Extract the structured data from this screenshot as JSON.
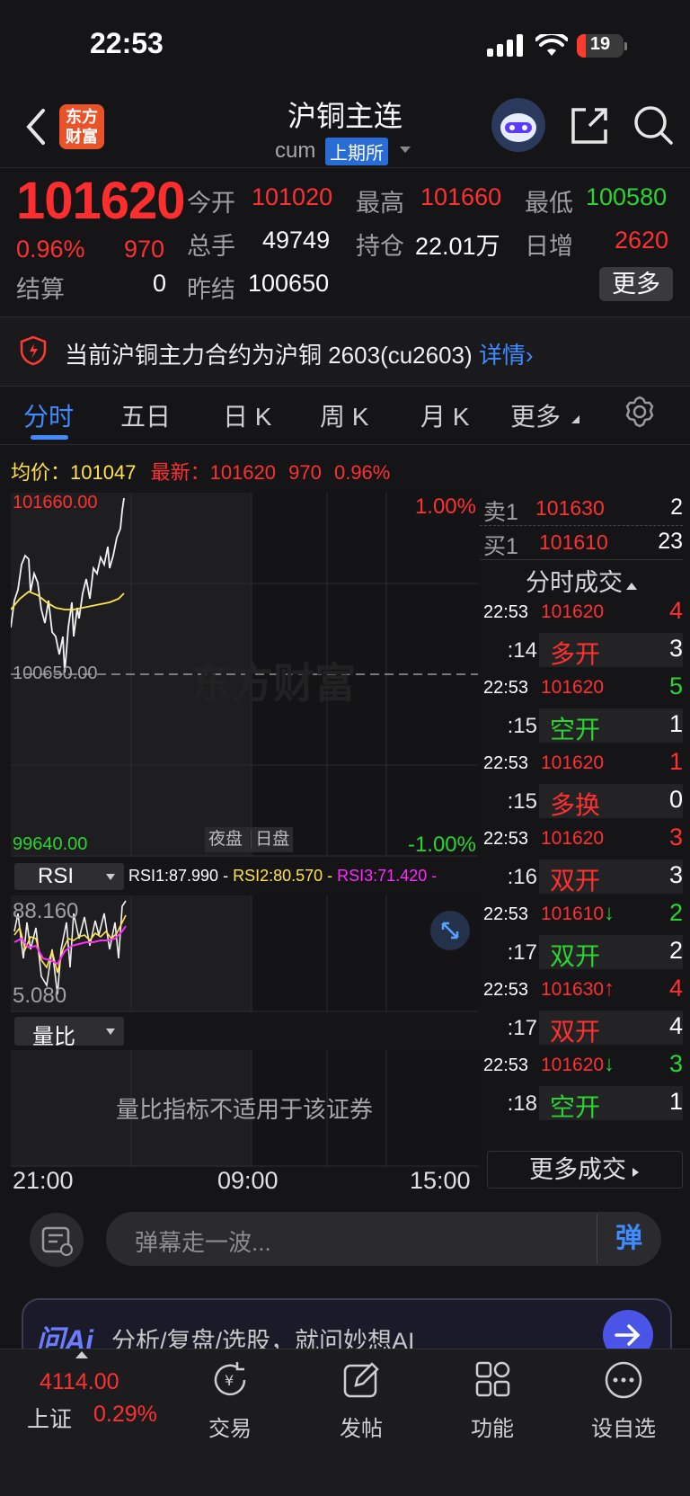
{
  "status": {
    "time": "22:53",
    "battery": 19
  },
  "header": {
    "title": "沪铜主连",
    "code": "cum",
    "exchange": "上期所",
    "logo_text": "东方财富"
  },
  "quote": {
    "last": "101620",
    "change_pct": "0.96%",
    "change": "970",
    "open_label": "今开",
    "open": "101020",
    "high_label": "最高",
    "high": "101660",
    "low_label": "最低",
    "low": "100580",
    "vol_label": "总手",
    "vol": "49749",
    "oi_label": "持仓",
    "oi": "22.01万",
    "daily_inc_label": "日增",
    "daily_inc": "2620",
    "settle_label": "结算",
    "settle": "0",
    "prev_settle_label": "昨结",
    "prev_settle": "100650",
    "more": "更多"
  },
  "notice": {
    "text": "当前沪铜主力合约为沪铜 2603(cu2603)",
    "link": "详情›"
  },
  "tabs": [
    "分时",
    "五日",
    "日 K",
    "周 K",
    "月 K",
    "更多"
  ],
  "info_line": {
    "avg_label": "均价：",
    "avg": "101047",
    "latest_label": "最新：",
    "latest": "101620",
    "change": "970",
    "pct": "0.96%"
  },
  "chart": {
    "top_price": "101660.00",
    "mid_price": "100650.00",
    "bottom_price": "99640.00",
    "top_pct": "1.00%",
    "bottom_pct": "-1.00%",
    "session_night": "夜盘",
    "session_day": "日盘",
    "watermark": "东方财富",
    "x_labels": [
      "21:00",
      "09:00",
      "15:00"
    ],
    "rsi": {
      "selector": "RSI",
      "rsi1": "RSI1:87.990",
      "rsi2": "RSI2:80.570",
      "rsi3": "RSI3:71.420",
      "top": "88.160",
      "bottom": "5.080"
    },
    "volume_ratio": {
      "selector": "量比",
      "message": "量比指标不适用于该证券"
    }
  },
  "order_book": {
    "ask": {
      "label": "卖1",
      "price": "101630",
      "vol": "2"
    },
    "bid": {
      "label": "买1",
      "price": "101610",
      "vol": "23"
    }
  },
  "trades": {
    "title": "分时成交",
    "rows": [
      {
        "time": "22:53",
        "price": "101620",
        "arrow": "",
        "vol": "4",
        "vol_color": "red",
        "sec": ":14",
        "type": "多开",
        "type_color": "red",
        "type_vol": "3"
      },
      {
        "time": "22:53",
        "price": "101620",
        "arrow": "",
        "vol": "5",
        "vol_color": "green",
        "sec": ":15",
        "type": "空开",
        "type_color": "green",
        "type_vol": "1"
      },
      {
        "time": "22:53",
        "price": "101620",
        "arrow": "",
        "vol": "1",
        "vol_color": "red",
        "sec": ":15",
        "type": "多换",
        "type_color": "red",
        "type_vol": "0"
      },
      {
        "time": "22:53",
        "price": "101620",
        "arrow": "",
        "vol": "3",
        "vol_color": "red",
        "sec": ":16",
        "type": "双开",
        "type_color": "red",
        "type_vol": "3"
      },
      {
        "time": "22:53",
        "price": "101610",
        "arrow": "↓",
        "vol": "2",
        "vol_color": "green",
        "sec": ":17",
        "type": "双开",
        "type_color": "green",
        "type_vol": "2"
      },
      {
        "time": "22:53",
        "price": "101630",
        "arrow": "↑",
        "vol": "4",
        "vol_color": "red",
        "sec": ":17",
        "type": "双开",
        "type_color": "red",
        "type_vol": "4"
      },
      {
        "time": "22:53",
        "price": "101620",
        "arrow": "↓",
        "vol": "3",
        "vol_color": "green",
        "sec": ":18",
        "type": "空开",
        "type_color": "green",
        "type_vol": "1"
      }
    ],
    "more": "更多成交"
  },
  "comment": {
    "placeholder": "弹幕走一波...",
    "danmu": "弹"
  },
  "ai": {
    "brand": "问Ai",
    "placeholder": "分析/复盘/选股，就问妙想AI"
  },
  "bottom_nav": {
    "index_value": "4114.00",
    "index_name": "上证",
    "index_pct": "0.29%",
    "items": [
      "交易",
      "发帖",
      "功能",
      "设自选"
    ]
  },
  "colors": {
    "up": "#ff3030",
    "down": "#2bd430",
    "accent": "#3f8cff",
    "avg_line": "#ffe34d",
    "rsi3": "#ff2bff"
  }
}
